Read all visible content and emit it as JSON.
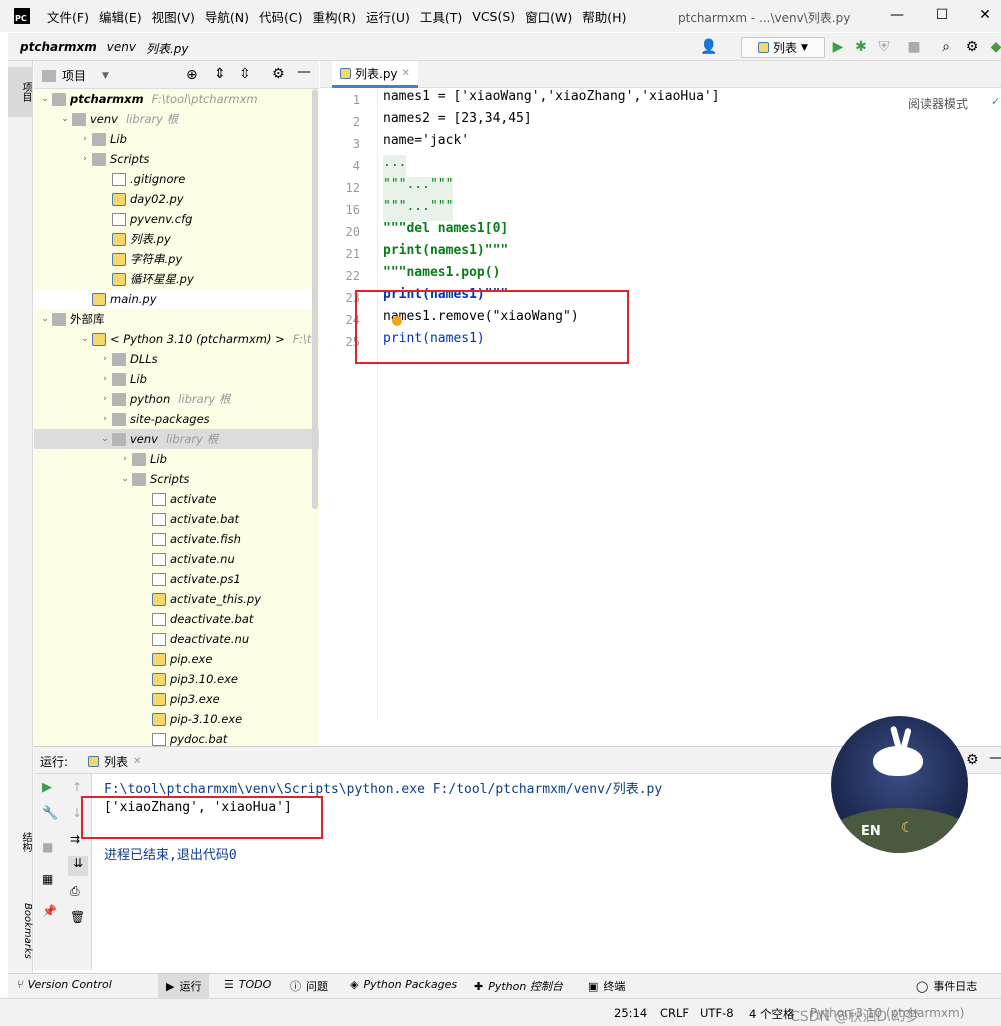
{
  "app": {
    "logo_text": "PC",
    "window_title": "ptcharmxm - ...\\venv\\列表.py",
    "menu": [
      "文件(F)",
      "编辑(E)",
      "视图(V)",
      "导航(N)",
      "代码(C)",
      "重构(R)",
      "运行(U)",
      "工具(T)",
      "VCS(S)",
      "窗口(W)",
      "帮助(H)"
    ]
  },
  "navbar": {
    "crumbs": [
      "ptcharmxm",
      "venv",
      "列表.py"
    ],
    "run_config": "列表"
  },
  "left_stripe": {
    "project_tab": "项目",
    "structure_tab": "结构",
    "bookmarks_tab": "Bookmarks"
  },
  "project_panel": {
    "title": "项目",
    "tree": [
      {
        "label": "ptcharmxm",
        "hint": "F:\\tool\\ptcharmxm",
        "arrow": "v",
        "icon": "folder"
      },
      {
        "label": "venv",
        "hint": "library 根",
        "arrow": "v",
        "icon": "folder"
      },
      {
        "label": "Lib",
        "hint": "",
        "arrow": ">",
        "icon": "folder"
      },
      {
        "label": "Scripts",
        "hint": "",
        "arrow": ">",
        "icon": "folder"
      },
      {
        "label": ".gitignore",
        "hint": "",
        "arrow": "",
        "icon": "txt"
      },
      {
        "label": "day02.py",
        "hint": "",
        "arrow": "",
        "icon": "py"
      },
      {
        "label": "pyvenv.cfg",
        "hint": "",
        "arrow": "",
        "icon": "txt"
      },
      {
        "label": "列表.py",
        "hint": "",
        "arrow": "",
        "icon": "py"
      },
      {
        "label": "字符串.py",
        "hint": "",
        "arrow": "",
        "icon": "py"
      },
      {
        "label": "循环星星.py",
        "hint": "",
        "arrow": "",
        "icon": "py"
      },
      {
        "label": "main.py",
        "hint": "",
        "arrow": "",
        "icon": "py"
      },
      {
        "label": "外部库",
        "hint": "",
        "arrow": "v",
        "icon": "lib"
      },
      {
        "label": "< Python 3.10 (ptcharmxm) >",
        "hint": "F:\\tool",
        "arrow": "v",
        "icon": "python"
      },
      {
        "label": "DLLs",
        "hint": "",
        "arrow": ">",
        "icon": "folder"
      },
      {
        "label": "Lib",
        "hint": "",
        "arrow": ">",
        "icon": "folder"
      },
      {
        "label": "python",
        "hint": "library 根",
        "arrow": ">",
        "icon": "folder"
      },
      {
        "label": "site-packages",
        "hint": "",
        "arrow": ">",
        "icon": "folder"
      },
      {
        "label": "venv",
        "hint": "library 根",
        "arrow": "v",
        "icon": "folder"
      },
      {
        "label": "Lib",
        "hint": "",
        "arrow": ">",
        "icon": "folder"
      },
      {
        "label": "Scripts",
        "hint": "",
        "arrow": "v",
        "icon": "folder"
      },
      {
        "label": "activate",
        "hint": "",
        "arrow": "",
        "icon": "txt"
      },
      {
        "label": "activate.bat",
        "hint": "",
        "arrow": "",
        "icon": "txt"
      },
      {
        "label": "activate.fish",
        "hint": "",
        "arrow": "",
        "icon": "txt"
      },
      {
        "label": "activate.nu",
        "hint": "",
        "arrow": "",
        "icon": "txt"
      },
      {
        "label": "activate.ps1",
        "hint": "",
        "arrow": "",
        "icon": "txt"
      },
      {
        "label": "activate_this.py",
        "hint": "",
        "arrow": "",
        "icon": "py"
      },
      {
        "label": "deactivate.bat",
        "hint": "",
        "arrow": "",
        "icon": "txt"
      },
      {
        "label": "deactivate.nu",
        "hint": "",
        "arrow": "",
        "icon": "txt"
      },
      {
        "label": "pip.exe",
        "hint": "",
        "arrow": "",
        "icon": "exe"
      },
      {
        "label": "pip3.10.exe",
        "hint": "",
        "arrow": "",
        "icon": "exe"
      },
      {
        "label": "pip3.exe",
        "hint": "",
        "arrow": "",
        "icon": "exe"
      },
      {
        "label": "pip-3.10.exe",
        "hint": "",
        "arrow": "",
        "icon": "exe"
      },
      {
        "label": "pydoc.bat",
        "hint": "",
        "arrow": "",
        "icon": "txt"
      }
    ]
  },
  "editor": {
    "tab_label": "列表.py",
    "reader_mode": "阅读器模式",
    "line_numbers": [
      "1",
      "2",
      "3",
      "4",
      "12",
      "16",
      "20",
      "21",
      "22",
      "23",
      "24",
      "25"
    ],
    "lines": [
      "names1 = ['xiaoWang','xiaoZhang','xiaoHua']",
      "names2 = [23,34,45]",
      "name='jack'",
      "...",
      "\"\"\"...\"\"\"",
      "\"\"\"...\"\"\"",
      "\"\"\"del names1[0]",
      "print(names1)\"\"\"",
      "\"\"\"names1.pop()",
      "print(names1)\"\"\"",
      "names1.remove(\"xiaoWang\")",
      "print(names1)"
    ]
  },
  "run_panel": {
    "label": "运行:",
    "tab": "列表",
    "output": [
      "F:\\tool\\ptcharmxm\\venv\\Scripts\\python.exe F:/tool/ptcharmxm/venv/列表.py",
      "['xiaoZhang', 'xiaoHua']",
      "",
      "进程已结束,退出代码0"
    ]
  },
  "bottom_tools": {
    "version_control": "Version Control",
    "run": "运行",
    "todo": "TODO",
    "problems": "问题",
    "python_packages": "Python Packages",
    "python_console": "Python 控制台",
    "terminal": "终端",
    "event_log": "事件日志"
  },
  "status": {
    "position": "25:14",
    "line_sep": "CRLF",
    "encoding": "UTF-8",
    "indent": "4 个空格",
    "interpreter": "Python 3.10 (ptcharmxm)",
    "watermark": "CSDN @秋洄D.幻梦"
  },
  "avatar": {
    "badge": "EN"
  },
  "colors": {
    "highlight_box": "#e0232a",
    "string_green": "#067d17",
    "keyword_blue": "#0033b3",
    "number_blue": "#1750eb",
    "selection": "#dcdcdc"
  }
}
